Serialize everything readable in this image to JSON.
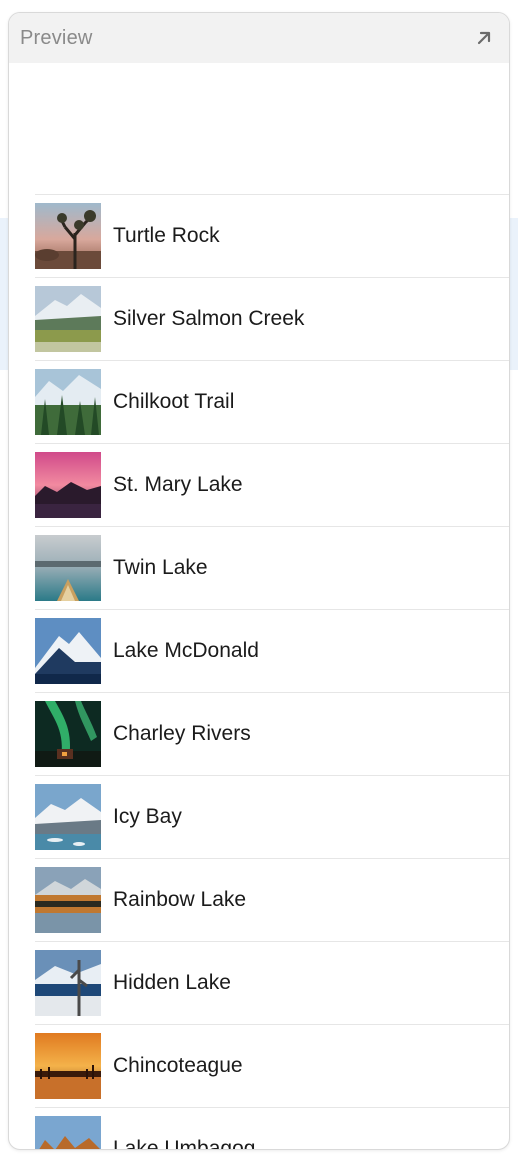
{
  "window": {
    "title": "Preview"
  },
  "landmarks": [
    {
      "name": "Turtle Rock",
      "thumb": "desert-tree"
    },
    {
      "name": "Silver Salmon Creek",
      "thumb": "meadow-mountain"
    },
    {
      "name": "Chilkoot Trail",
      "thumb": "forest-mountain"
    },
    {
      "name": "St. Mary Lake",
      "thumb": "pink-sky-lake"
    },
    {
      "name": "Twin Lake",
      "thumb": "canoe-lake"
    },
    {
      "name": "Lake McDonald",
      "thumb": "snowy-peak"
    },
    {
      "name": "Charley Rivers",
      "thumb": "aurora-cabin"
    },
    {
      "name": "Icy Bay",
      "thumb": "glacier-bay"
    },
    {
      "name": "Rainbow Lake",
      "thumb": "reflection-lake"
    },
    {
      "name": "Hidden Lake",
      "thumb": "winter-lake"
    },
    {
      "name": "Chincoteague",
      "thumb": "sunset-marsh"
    },
    {
      "name": "Lake Umbagog",
      "thumb": "autumn-lake"
    }
  ],
  "colors": {
    "header_bg": "#f2f2f2",
    "title_text": "#8a8a8a",
    "row_text": "#1b1b1b",
    "separator": "#e6e6e6"
  }
}
